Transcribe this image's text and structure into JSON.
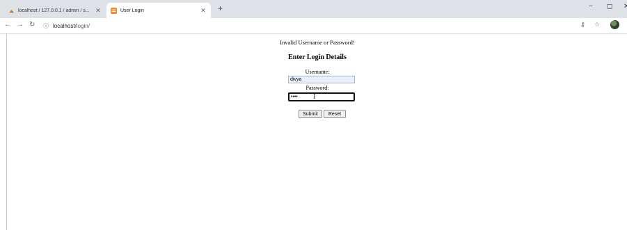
{
  "browser": {
    "tabs": [
      {
        "title": "localhost / 127.0.0.1 / admin / s...",
        "active": false
      },
      {
        "title": "User Login",
        "active": true
      }
    ],
    "new_tab_symbol": "+",
    "url_host": "localhost",
    "url_path": "/login/",
    "window_controls": [
      "−",
      "◻",
      "✕"
    ]
  },
  "page": {
    "error_message": "Invalid Username or Password!",
    "heading": "Enter Login Details",
    "username_label": "Username:",
    "username_value": "divya",
    "password_label": "Password:",
    "password_value": "••••",
    "submit_label": "Submit",
    "reset_label": "Reset"
  },
  "colors": {
    "tabstrip": "#dee1e6",
    "autofill": "#e8f0fe"
  },
  "icons": [
    "back-arrow-icon",
    "forward-arrow-icon",
    "reload-icon",
    "info-icon",
    "key-icon",
    "star-icon",
    "profile-avatar-icon"
  ]
}
